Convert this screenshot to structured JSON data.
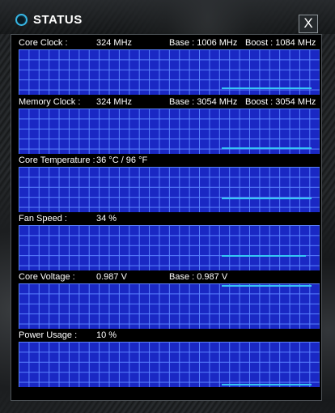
{
  "window": {
    "title": "STATUS",
    "close_label": "X"
  },
  "graphs": [
    {
      "id": "core-clock",
      "label": "Core Clock :",
      "value": "324 MHz",
      "base": "Base : 1006 MHz",
      "boost": "Boost : 1084 MHz",
      "series_level": 0.14
    },
    {
      "id": "memory-clock",
      "label": "Memory Clock :",
      "value": "324 MHz",
      "base": "Base : 3054 MHz",
      "boost": "Boost : 3054 MHz",
      "series_level": 0.12
    },
    {
      "id": "core-temperature",
      "label": "Core Temperature :",
      "value": "36 °C / 96 °F",
      "base": "",
      "boost": "",
      "series_level": 0.31
    },
    {
      "id": "fan-speed",
      "label": "Fan Speed :",
      "value": "34 %",
      "base": "",
      "boost": "",
      "series_level": 0.34
    },
    {
      "id": "core-voltage",
      "label": "Core Voltage :",
      "value": "0.987 V",
      "base": "Base : 0.987 V",
      "boost": "",
      "series_level": 0.99
    },
    {
      "id": "power-usage",
      "label": "Power Usage :",
      "value": "10 %",
      "base": "",
      "boost": "",
      "series_level": 0.04
    }
  ],
  "colors": {
    "graph_bg": "#1a28c4",
    "grid": "#5a82ff",
    "line": "#35c6f4",
    "accent": "#37b6e4"
  }
}
